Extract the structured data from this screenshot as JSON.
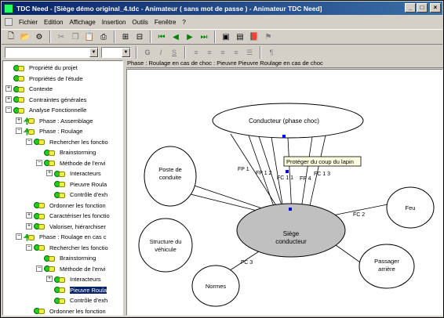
{
  "window": {
    "title": "TDC Need - [Siège démo original_4.tdc - Animateur ( sans mot de passe ) - Animateur TDC Need]",
    "minimize": "_",
    "maximize": "□",
    "close": "×"
  },
  "menu": [
    "Fichier",
    "Edition",
    "Affichage",
    "Insertion",
    "Outils",
    "Fenêtre",
    "?"
  ],
  "format_bar": {
    "font_combo": "",
    "size_combo": "",
    "bold": "G",
    "italic": "I",
    "underline": "S",
    "para": "¶"
  },
  "tree": [
    {
      "label": "Propriété du projet",
      "level": 0,
      "pm": ""
    },
    {
      "label": "Propriétés de l'étude",
      "level": 0,
      "pm": ""
    },
    {
      "label": "Contexte",
      "level": 0,
      "pm": "+"
    },
    {
      "label": "Contraintes générales",
      "level": 0,
      "pm": "+"
    },
    {
      "label": "Analyse Fonctionnelle",
      "level": 0,
      "pm": "-"
    },
    {
      "label": "Phase : Assemblage",
      "level": 1,
      "pm": "+"
    },
    {
      "label": "Phase : Roulage",
      "level": 1,
      "pm": "-"
    },
    {
      "label": "Rechercher les fonctio",
      "level": 2,
      "pm": "-"
    },
    {
      "label": "Brainstorming",
      "level": 3,
      "pm": ""
    },
    {
      "label": "Méthode de l'envi",
      "level": 3,
      "pm": "-"
    },
    {
      "label": "Interacteurs",
      "level": 4,
      "pm": "+"
    },
    {
      "label": "Pieuvre Roula",
      "level": 4,
      "pm": ""
    },
    {
      "label": "Contrôle d'exh",
      "level": 4,
      "pm": ""
    },
    {
      "label": "Ordonner les fonction",
      "level": 2,
      "pm": ""
    },
    {
      "label": "Caractériser les fonctio",
      "level": 2,
      "pm": "+"
    },
    {
      "label": "Valoriser, hiérarchiser",
      "level": 2,
      "pm": "+"
    },
    {
      "label": "Phase : Roulage en cas c",
      "level": 1,
      "pm": "-"
    },
    {
      "label": "Rechercher les fonctio",
      "level": 2,
      "pm": "-"
    },
    {
      "label": "Brainstorming",
      "level": 3,
      "pm": ""
    },
    {
      "label": "Méthode de l'envi",
      "level": 3,
      "pm": "-"
    },
    {
      "label": "Interacteurs",
      "level": 4,
      "pm": "+"
    },
    {
      "label": "Pieuvre Roula",
      "level": 4,
      "pm": "",
      "selected": true
    },
    {
      "label": "Contrôle d'exh",
      "level": 4,
      "pm": ""
    },
    {
      "label": "Ordonner les fonction",
      "level": 2,
      "pm": ""
    }
  ],
  "diagram": {
    "header": "Phase : Roulage en cas de choc  :  Pieuvre  Pieuvre Roulage en cas de choc",
    "center": "Siège\nconducteur",
    "nodes": {
      "conducteur": "Conducteur (phase choc)",
      "poste": "Poste de\nconduite",
      "structure": "Structure du\nvéhicule",
      "normes": "Normes",
      "passager": "Passager\narrière",
      "feu": "Feu"
    },
    "labels": {
      "fp1": "FP 1",
      "fp12": "FP 1 2",
      "fc11": "FC 1 1",
      "fp4": "FP 4",
      "fc13": "FC 1 3",
      "fc2": "FC 2",
      "fc3": "FC 3"
    },
    "tooltip": "Protéger du coup du lapin"
  }
}
